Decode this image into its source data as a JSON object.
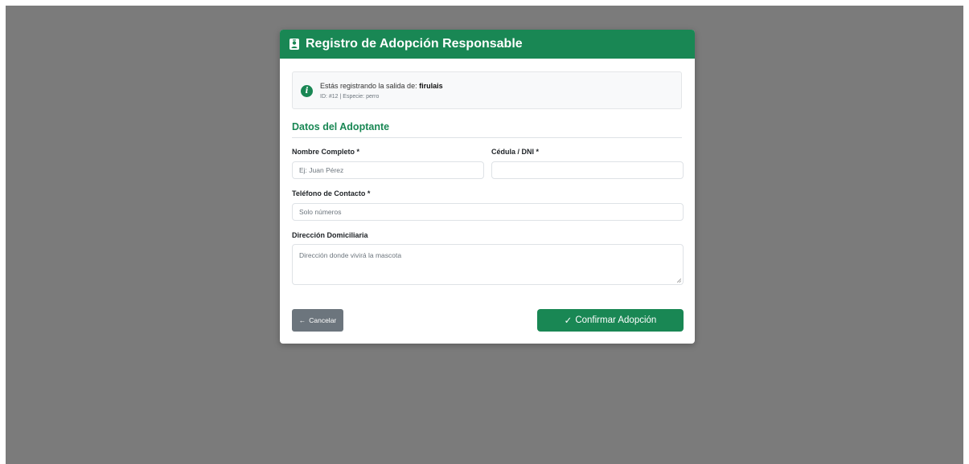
{
  "modal": {
    "title": "Registro de Adopción Responsable",
    "header_icon": "person-badge-icon",
    "accent_color": "#198754"
  },
  "info": {
    "icon": "info-icon",
    "icon_glyph": "i",
    "text_prefix": "Estás registrando la salida de:",
    "pet_name": "firulais",
    "meta": "ID: #12 | Especie: perro"
  },
  "section": {
    "title": "Datos del Adoptante"
  },
  "form": {
    "nombre": {
      "label": "Nombre Completo *",
      "placeholder": "Ej: Juan Pérez",
      "value": ""
    },
    "cedula": {
      "label": "Cédula / DNI *",
      "placeholder": "",
      "value": ""
    },
    "telefono": {
      "label": "Teléfono de Contacto *",
      "placeholder": "Solo números",
      "value": ""
    },
    "direccion": {
      "label": "Dirección Domiciliaria",
      "placeholder": "Dirección donde vivirá la mascota",
      "value": ""
    }
  },
  "actions": {
    "cancel_icon": "←",
    "cancel_label": "Cancelar",
    "confirm_icon": "✓",
    "confirm_label": "Confirmar Adopción",
    "cancel_color": "#6c757d"
  }
}
